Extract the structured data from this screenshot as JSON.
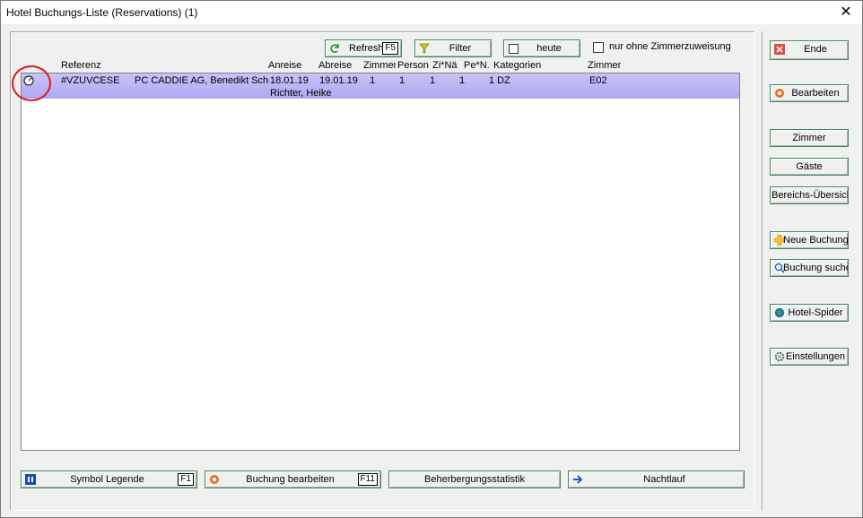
{
  "window": {
    "title": "Hotel Buchungs-Liste (Reservations) (1)",
    "close_glyph": "✕"
  },
  "toolbar": {
    "refresh_label": "Refresh",
    "refresh_key": "F5",
    "filter_label": "Filter",
    "today_label": "heute",
    "no_room_label": "nur ohne Zimmerzuweisung"
  },
  "columns": {
    "referenz": "Referenz",
    "anreise": "Anreise",
    "abreise": "Abreise",
    "zimmer_count": "Zimmer",
    "personen": "Person",
    "zi_nae": "Zi*Nä",
    "pe_n": "Pe*N.",
    "kategorien": "Kategorien",
    "zimmer": "Zimmer"
  },
  "rows": [
    {
      "referenz": "#VZUVCESE",
      "name": "PC CADDIE AG, Benedikt Schn",
      "name2": "Richter, Heike",
      "anreise": "18.01.19",
      "abreise": "19.01.19",
      "zimmer_count": "1",
      "personen": "1",
      "zi_nae": "1",
      "pe_n": "1",
      "kategorien": "1 DZ",
      "zimmer": "E02"
    }
  ],
  "bottom": {
    "legend_label": "Symbol Legende",
    "legend_key": "F1",
    "edit_label": "Buchung bearbeiten",
    "edit_key": "F11",
    "stats_label": "Beherbergungsstatistik",
    "night_label": "Nachtlauf"
  },
  "side": {
    "ende": "Ende",
    "bearbeiten": "Bearbeiten",
    "zimmer": "Zimmer",
    "gaeste": "Gäste",
    "bereichs": "Bereichs-Übersich",
    "neue": "Neue Buchung",
    "suche": "Buchung suche",
    "spider": "Hotel-Spider",
    "einstellungen": "Einstellungen"
  },
  "colors": {
    "accent_border": "#3c8a52",
    "row_highlight": "#b7b2f4",
    "annotation": "#e0151b"
  }
}
